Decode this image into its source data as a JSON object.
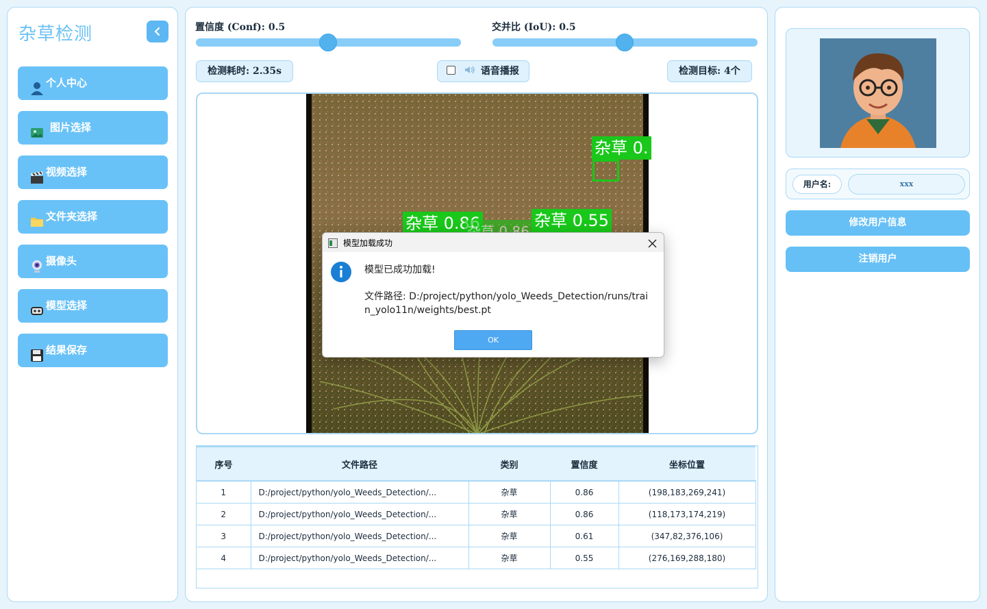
{
  "app": {
    "title": "杂草检测"
  },
  "nav": [
    {
      "label": "个人中心",
      "icon": "person-icon"
    },
    {
      "label": "图片选择",
      "icon": "image-icon"
    },
    {
      "label": "视频选择",
      "icon": "clapper-icon"
    },
    {
      "label": "文件夹选择",
      "icon": "folder-icon"
    },
    {
      "label": "摄像头",
      "icon": "webcam-icon"
    },
    {
      "label": "模型选择",
      "icon": "model-icon"
    },
    {
      "label": "结果保存",
      "icon": "floppy-icon"
    }
  ],
  "sliders": {
    "conf": {
      "label": "置信度 (Conf): 0.5",
      "value": 0.5
    },
    "iou": {
      "label": "交并比 (IoU): 0.5",
      "value": 0.5
    }
  },
  "info": {
    "time": "检测耗时: 2.35s",
    "voice": "语音播报",
    "targets": "检测目标: 4个"
  },
  "detections_overlay": [
    {
      "label": "杂草 0."
    },
    {
      "label": "杂草 0.86"
    },
    {
      "label": "杂草 0.86"
    },
    {
      "label": "杂草 0.55"
    }
  ],
  "table": {
    "headers": [
      "序号",
      "文件路径",
      "类别",
      "置信度",
      "坐标位置"
    ],
    "rows": [
      [
        "1",
        "D:/project/python/yolo_Weeds_Detection/...",
        "杂草",
        "0.86",
        "(198,183,269,241)"
      ],
      [
        "2",
        "D:/project/python/yolo_Weeds_Detection/...",
        "杂草",
        "0.86",
        "(118,173,174,219)"
      ],
      [
        "3",
        "D:/project/python/yolo_Weeds_Detection/...",
        "杂草",
        "0.61",
        "(347,82,376,106)"
      ],
      [
        "4",
        "D:/project/python/yolo_Weeds_Detection/...",
        "杂草",
        "0.55",
        "(276,169,288,180)"
      ]
    ]
  },
  "user": {
    "label": "用户名:",
    "name": "xxx",
    "edit_button": "修改用户信息",
    "logout_button": "注销用户"
  },
  "dialog": {
    "title": "模型加载成功",
    "message": "模型已成功加载!",
    "path": "文件路径: D:/project/python/yolo_Weeds_Detection/runs/train_yolo11n/weights/best.pt",
    "ok": "OK"
  },
  "colors": {
    "accent": "#69c2f7",
    "detection": "#19c81a",
    "border": "#a9d8f5"
  }
}
